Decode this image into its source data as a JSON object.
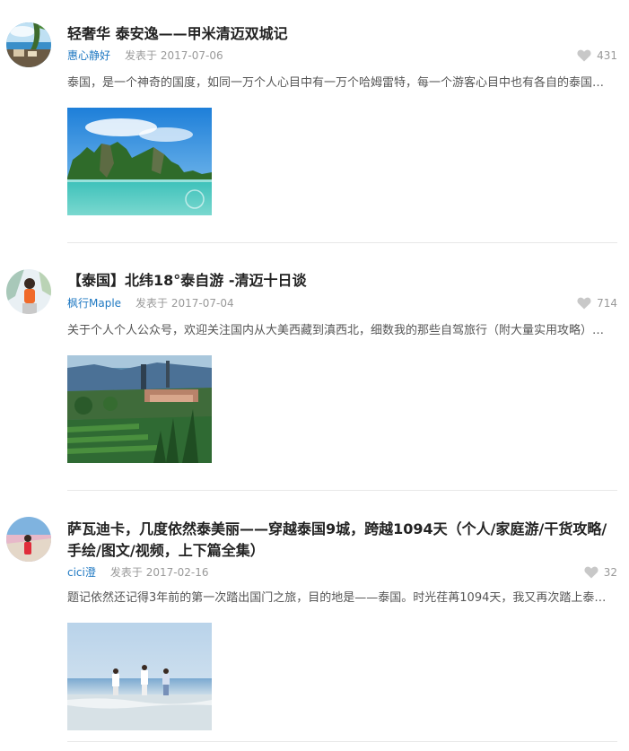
{
  "posts": [
    {
      "title": "轻奢华 泰安逸——甲米清迈双城记",
      "author": "惠心静好",
      "date_prefix": "发表于",
      "date": "2017-07-06",
      "likes": "431",
      "excerpt": "泰国，是一个神奇的国度，如同一万个人心目中有一万个哈姆雷特，每一个游客心目中也有各自的泰国…"
    },
    {
      "title": "【泰国】北纬18°泰自游 -清迈十日谈",
      "author": "枫行Maple",
      "date_prefix": "发表于",
      "date": "2017-07-04",
      "likes": "714",
      "excerpt": "关于个人个人公众号，欢迎关注国内从大美西藏到滇西北，细数我的那些自驾旅行（附大量实用攻略）…"
    },
    {
      "title_line1": "萨瓦迪卡，几度依然泰美丽——穿越泰国9城，跨越1094天（个人/家庭游/干货攻略/",
      "title_line2": "手绘/图文/视频，上下篇全集）",
      "author": "cici澄",
      "date_prefix": "发表于",
      "date": "2017-02-16",
      "likes": "32",
      "excerpt": "题记依然还记得3年前的第一次踏出国门之旅，目的地是——泰国。时光荏苒1094天，我又再次踏上泰国…"
    }
  ],
  "icons": {
    "like": "heart-icon"
  },
  "colors": {
    "author_link": "#1e78c2",
    "meta_gray": "#999999",
    "divider": "#e8e8e8"
  }
}
